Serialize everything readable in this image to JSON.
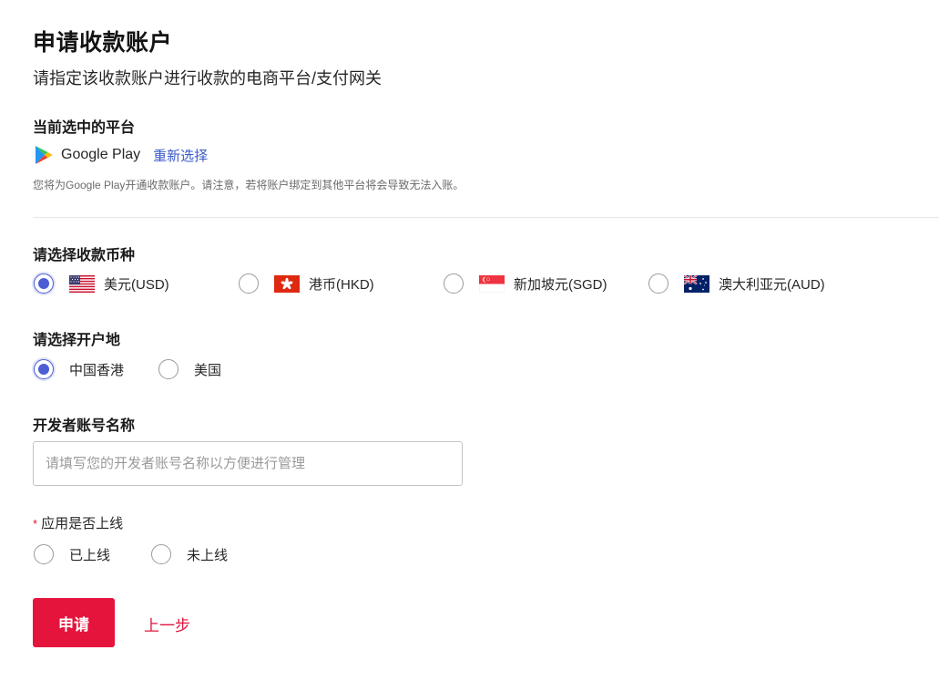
{
  "page": {
    "title": "申请收款账户",
    "subtitle": "请指定该收款账户进行收款的电商平台/支付网关"
  },
  "platform": {
    "section_label": "当前选中的平台",
    "name": "Google Play",
    "icon": "google-play-icon",
    "reselect_label": "重新选择",
    "note": "您将为Google Play开通收款账户。请注意，若将账户绑定到其他平台将会导致无法入账。"
  },
  "currency": {
    "section_label": "请选择收款币种",
    "selected": "USD",
    "options": [
      {
        "label": "美元(USD)",
        "flag": "us-flag",
        "checked": true
      },
      {
        "label": "港币(HKD)",
        "flag": "hk-flag",
        "checked": false
      },
      {
        "label": "新加坡元(SGD)",
        "flag": "sg-flag",
        "checked": false
      },
      {
        "label": "澳大利亚元(AUD)",
        "flag": "au-flag",
        "checked": false
      }
    ]
  },
  "region": {
    "section_label": "请选择开户地",
    "options": [
      {
        "label": "中国香港",
        "checked": true
      },
      {
        "label": "美国",
        "checked": false
      }
    ]
  },
  "developer": {
    "section_label": "开发者账号名称",
    "value": "",
    "placeholder": "请填写您的开发者账号名称以方便进行管理"
  },
  "online": {
    "required_mark": "*",
    "section_label": "应用是否上线",
    "options": [
      {
        "label": "已上线",
        "checked": false
      },
      {
        "label": "未上线",
        "checked": false
      }
    ]
  },
  "actions": {
    "submit_label": "申请",
    "back_label": "上一步"
  },
  "colors": {
    "accent": "#e5143c",
    "radio_selected": "#4b5ed3",
    "link": "#3a59c9"
  }
}
